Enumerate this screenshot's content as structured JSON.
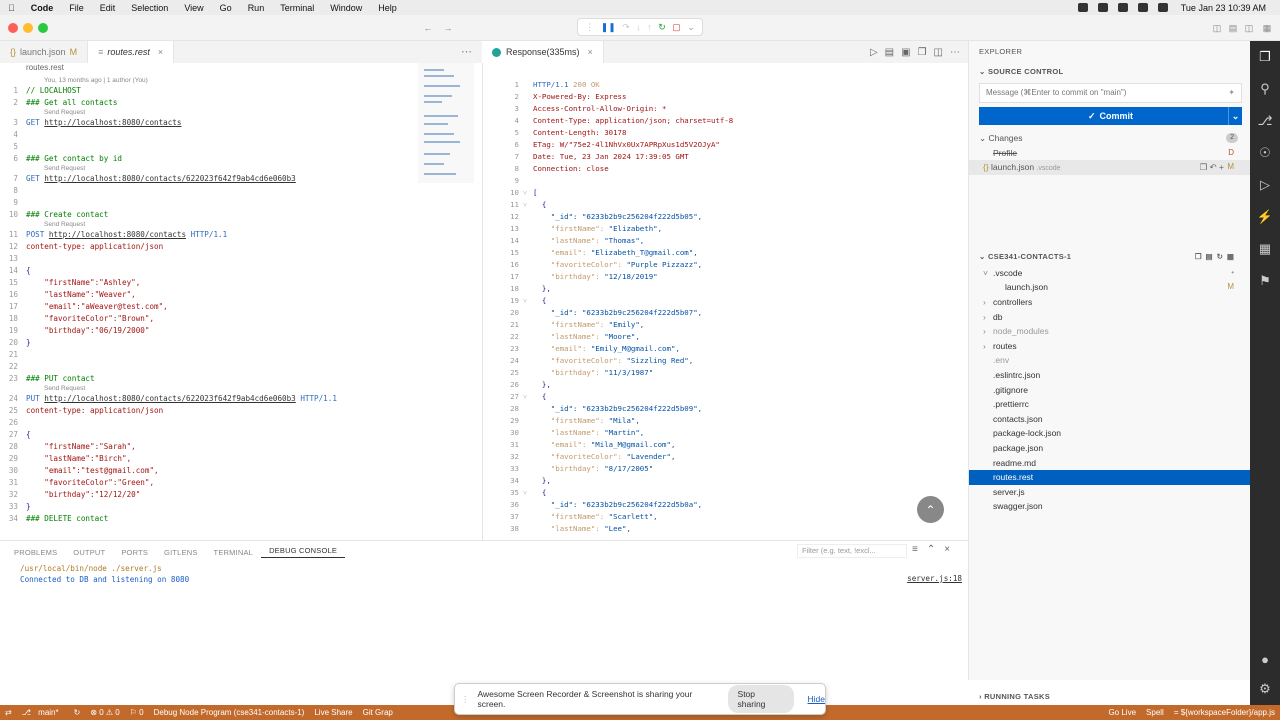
{
  "menubar": {
    "apple": "",
    "items": [
      "Code",
      "File",
      "Edit",
      "Selection",
      "View",
      "Go",
      "Run",
      "Terminal",
      "Window",
      "Help"
    ],
    "clock": "Tue Jan 23  10:39 AM"
  },
  "editor_tabs": [
    {
      "label": "launch.json",
      "mod": "M",
      "active": false
    },
    {
      "label": "routes.rest",
      "mod": "",
      "active": true
    }
  ],
  "response_tab": {
    "label": "Response(335ms)"
  },
  "editor": {
    "breadcrumb": "routes.rest",
    "blame": "You, 13 months ago | 1 author (You)",
    "lines": [
      {
        "n": "1",
        "hint": "",
        "parts": [
          {
            "t": "// LOCALHOST",
            "c": "k3"
          }
        ]
      },
      {
        "n": "2",
        "hint": "",
        "parts": [
          {
            "t": "### Get all contacts",
            "c": "k3"
          }
        ]
      },
      {
        "n": "",
        "hint": "Send Request",
        "parts": []
      },
      {
        "n": "3",
        "hint": "",
        "parts": [
          {
            "t": "GET ",
            "c": "k1"
          },
          {
            "t": "http://localhost:8080/contacts",
            "c": "k5"
          }
        ]
      },
      {
        "n": "4",
        "hint": "",
        "parts": []
      },
      {
        "n": "5",
        "hint": "",
        "parts": []
      },
      {
        "n": "6",
        "hint": "",
        "parts": [
          {
            "t": "### Get contact by id",
            "c": "k3"
          }
        ]
      },
      {
        "n": "",
        "hint": "Send Request",
        "parts": []
      },
      {
        "n": "7",
        "hint": "",
        "parts": [
          {
            "t": "GET ",
            "c": "k1"
          },
          {
            "t": "http://localhost:8080/contacts/622023f642f9ab4cd6e060b3",
            "c": "k5"
          }
        ]
      },
      {
        "n": "8",
        "hint": "",
        "parts": []
      },
      {
        "n": "9",
        "hint": "",
        "parts": []
      },
      {
        "n": "10",
        "hint": "",
        "parts": [
          {
            "t": "### Create contact",
            "c": "k3"
          }
        ]
      },
      {
        "n": "",
        "hint": "Send Request",
        "parts": []
      },
      {
        "n": "11",
        "hint": "",
        "parts": [
          {
            "t": "POST ",
            "c": "k1"
          },
          {
            "t": "http://localhost:8080/contacts",
            "c": "k5"
          },
          {
            "t": " HTTP/1.1",
            "c": "k1"
          }
        ]
      },
      {
        "n": "12",
        "hint": "",
        "parts": [
          {
            "t": "content-type: application/json",
            "c": "k2"
          }
        ]
      },
      {
        "n": "13",
        "hint": "",
        "parts": []
      },
      {
        "n": "14",
        "hint": "",
        "parts": [
          {
            "t": "{",
            "c": "kp"
          }
        ]
      },
      {
        "n": "15",
        "hint": "",
        "parts": [
          {
            "t": "    \"firstName\":\"Ashley\",",
            "c": "k2"
          }
        ]
      },
      {
        "n": "16",
        "hint": "",
        "parts": [
          {
            "t": "    \"lastName\":\"Weaver\",",
            "c": "k2"
          }
        ]
      },
      {
        "n": "17",
        "hint": "",
        "parts": [
          {
            "t": "    \"email\":\"aWeaver@test.com\",",
            "c": "k2"
          }
        ]
      },
      {
        "n": "18",
        "hint": "",
        "parts": [
          {
            "t": "    \"favoriteColor\":\"Brown\",",
            "c": "k2"
          }
        ]
      },
      {
        "n": "19",
        "hint": "",
        "parts": [
          {
            "t": "    \"birthday\":\"06/19/2000\"",
            "c": "k2"
          }
        ]
      },
      {
        "n": "20",
        "hint": "",
        "parts": [
          {
            "t": "}",
            "c": "kp"
          }
        ]
      },
      {
        "n": "21",
        "hint": "",
        "parts": []
      },
      {
        "n": "22",
        "hint": "",
        "parts": []
      },
      {
        "n": "23",
        "hint": "",
        "parts": [
          {
            "t": "### PUT contact",
            "c": "k3"
          }
        ]
      },
      {
        "n": "",
        "hint": "Send Request",
        "parts": []
      },
      {
        "n": "24",
        "hint": "",
        "parts": [
          {
            "t": "PUT ",
            "c": "k1"
          },
          {
            "t": "http://localhost:8080/contacts/622023f642f9ab4cd6e060b3",
            "c": "k5"
          },
          {
            "t": " HTTP/1.1",
            "c": "k1"
          }
        ]
      },
      {
        "n": "25",
        "hint": "",
        "parts": [
          {
            "t": "content-type: application/json",
            "c": "k2"
          }
        ]
      },
      {
        "n": "26",
        "hint": "",
        "parts": []
      },
      {
        "n": "27",
        "hint": "",
        "parts": [
          {
            "t": "{",
            "c": "kp"
          }
        ]
      },
      {
        "n": "28",
        "hint": "",
        "parts": [
          {
            "t": "    \"firstName\":\"Sarah\",",
            "c": "k2"
          }
        ]
      },
      {
        "n": "29",
        "hint": "",
        "parts": [
          {
            "t": "    \"lastName\":\"Birch\",",
            "c": "k2"
          }
        ]
      },
      {
        "n": "30",
        "hint": "",
        "parts": [
          {
            "t": "    \"email\":\"test@gmail.com\",",
            "c": "k2"
          }
        ]
      },
      {
        "n": "31",
        "hint": "",
        "parts": [
          {
            "t": "    \"favoriteColor\":\"Green\",",
            "c": "k2"
          }
        ]
      },
      {
        "n": "32",
        "hint": "",
        "parts": [
          {
            "t": "    \"birthday\":\"12/12/20\"",
            "c": "k2"
          }
        ]
      },
      {
        "n": "33",
        "hint": "",
        "parts": [
          {
            "t": "}",
            "c": "kp"
          }
        ]
      },
      {
        "n": "34",
        "hint": "",
        "parts": [
          {
            "t": "### DELETE contact",
            "c": "k3"
          }
        ]
      }
    ]
  },
  "response": {
    "lines": [
      {
        "n": "1",
        "f": "",
        "parts": [
          {
            "t": "HTTP/1.1 ",
            "c": "k1"
          },
          {
            "t": "200 OK",
            "c": "ks"
          }
        ]
      },
      {
        "n": "2",
        "f": "",
        "parts": [
          {
            "t": "X-Powered-By: Express",
            "c": "k2"
          }
        ]
      },
      {
        "n": "3",
        "f": "",
        "parts": [
          {
            "t": "Access-Control-Allow-Origin: *",
            "c": "k2"
          }
        ]
      },
      {
        "n": "4",
        "f": "",
        "parts": [
          {
            "t": "Content-Type: application/json; charset=utf-8",
            "c": "k2"
          }
        ]
      },
      {
        "n": "5",
        "f": "",
        "parts": [
          {
            "t": "Content-Length: 30178",
            "c": "k2"
          }
        ]
      },
      {
        "n": "6",
        "f": "",
        "parts": [
          {
            "t": "ETag: W/\"75e2-4l1NhVx0Ux7APRpXus1d5V2OJyA\"",
            "c": "k2"
          }
        ]
      },
      {
        "n": "7",
        "f": "",
        "parts": [
          {
            "t": "Date: Tue, 23 Jan 2024 17:39:05 GMT",
            "c": "k2"
          }
        ]
      },
      {
        "n": "8",
        "f": "",
        "parts": [
          {
            "t": "Connection: close",
            "c": "k2"
          }
        ]
      },
      {
        "n": "9",
        "f": "",
        "parts": []
      },
      {
        "n": "10",
        "f": "v",
        "parts": [
          {
            "t": "[",
            "c": "kp"
          }
        ]
      },
      {
        "n": "11",
        "f": "v",
        "parts": [
          {
            "t": "  {",
            "c": "kp"
          }
        ]
      },
      {
        "n": "12",
        "f": "",
        "parts": [
          {
            "t": "    \"_id\": ",
            "c": "k4"
          },
          {
            "t": "\"6233b2b9c256204f222d5b05\",",
            "c": "jv"
          }
        ]
      },
      {
        "n": "13",
        "f": "",
        "parts": [
          {
            "t": "    \"firstName\": ",
            "c": "ks"
          },
          {
            "t": "\"Elizabeth\",",
            "c": "jv"
          }
        ]
      },
      {
        "n": "14",
        "f": "",
        "parts": [
          {
            "t": "    \"lastName\": ",
            "c": "ks"
          },
          {
            "t": "\"Thomas\",",
            "c": "jv"
          }
        ]
      },
      {
        "n": "15",
        "f": "",
        "parts": [
          {
            "t": "    \"email\": ",
            "c": "ks"
          },
          {
            "t": "\"Elizabeth_T@gmail.com\",",
            "c": "jv"
          }
        ]
      },
      {
        "n": "16",
        "f": "",
        "parts": [
          {
            "t": "    \"favoriteColor\": ",
            "c": "ks"
          },
          {
            "t": "\"Purple Pizzazz\",",
            "c": "jv"
          }
        ]
      },
      {
        "n": "17",
        "f": "",
        "parts": [
          {
            "t": "    \"birthday\": ",
            "c": "ks"
          },
          {
            "t": "\"12/18/2019\"",
            "c": "jv"
          }
        ]
      },
      {
        "n": "18",
        "f": "",
        "parts": [
          {
            "t": "  },",
            "c": "kp"
          }
        ]
      },
      {
        "n": "19",
        "f": "v",
        "parts": [
          {
            "t": "  {",
            "c": "kp"
          }
        ]
      },
      {
        "n": "20",
        "f": "",
        "parts": [
          {
            "t": "    \"_id\": ",
            "c": "k4"
          },
          {
            "t": "\"6233b2b9c256204f222d5b07\",",
            "c": "jv"
          }
        ]
      },
      {
        "n": "21",
        "f": "",
        "parts": [
          {
            "t": "    \"firstName\": ",
            "c": "ks"
          },
          {
            "t": "\"Emily\",",
            "c": "jv"
          }
        ]
      },
      {
        "n": "22",
        "f": "",
        "parts": [
          {
            "t": "    \"lastName\": ",
            "c": "ks"
          },
          {
            "t": "\"Moore\",",
            "c": "jv"
          }
        ]
      },
      {
        "n": "23",
        "f": "",
        "parts": [
          {
            "t": "    \"email\": ",
            "c": "ks"
          },
          {
            "t": "\"Emily_M@gmail.com\",",
            "c": "jv"
          }
        ]
      },
      {
        "n": "24",
        "f": "",
        "parts": [
          {
            "t": "    \"favoriteColor\": ",
            "c": "ks"
          },
          {
            "t": "\"Sizzling Red\",",
            "c": "jv"
          }
        ]
      },
      {
        "n": "25",
        "f": "",
        "parts": [
          {
            "t": "    \"birthday\": ",
            "c": "ks"
          },
          {
            "t": "\"11/3/1987\"",
            "c": "jv"
          }
        ]
      },
      {
        "n": "26",
        "f": "",
        "parts": [
          {
            "t": "  },",
            "c": "kp"
          }
        ]
      },
      {
        "n": "27",
        "f": "v",
        "parts": [
          {
            "t": "  {",
            "c": "kp"
          }
        ]
      },
      {
        "n": "28",
        "f": "",
        "parts": [
          {
            "t": "    \"_id\": ",
            "c": "k4"
          },
          {
            "t": "\"6233b2b9c256204f222d5b09\",",
            "c": "jv"
          }
        ]
      },
      {
        "n": "29",
        "f": "",
        "parts": [
          {
            "t": "    \"firstName\": ",
            "c": "ks"
          },
          {
            "t": "\"Mila\",",
            "c": "jv"
          }
        ]
      },
      {
        "n": "30",
        "f": "",
        "parts": [
          {
            "t": "    \"lastName\": ",
            "c": "ks"
          },
          {
            "t": "\"Martin\",",
            "c": "jv"
          }
        ]
      },
      {
        "n": "31",
        "f": "",
        "parts": [
          {
            "t": "    \"email\": ",
            "c": "ks"
          },
          {
            "t": "\"Mila_M@gmail.com\",",
            "c": "jv"
          }
        ]
      },
      {
        "n": "32",
        "f": "",
        "parts": [
          {
            "t": "    \"favoriteColor\": ",
            "c": "ks"
          },
          {
            "t": "\"Lavender\",",
            "c": "jv"
          }
        ]
      },
      {
        "n": "33",
        "f": "",
        "parts": [
          {
            "t": "    \"birthday\": ",
            "c": "ks"
          },
          {
            "t": "\"8/17/2005\"",
            "c": "jv"
          }
        ]
      },
      {
        "n": "34",
        "f": "",
        "parts": [
          {
            "t": "  },",
            "c": "kp"
          }
        ]
      },
      {
        "n": "35",
        "f": "v",
        "parts": [
          {
            "t": "  {",
            "c": "kp"
          }
        ]
      },
      {
        "n": "36",
        "f": "",
        "parts": [
          {
            "t": "    \"_id\": ",
            "c": "k4"
          },
          {
            "t": "\"6233b2b9c256204f222d5b0a\",",
            "c": "jv"
          }
        ]
      },
      {
        "n": "37",
        "f": "",
        "parts": [
          {
            "t": "    \"firstName\": ",
            "c": "ks"
          },
          {
            "t": "\"Scarlett\",",
            "c": "jv"
          }
        ]
      },
      {
        "n": "38",
        "f": "",
        "parts": [
          {
            "t": "    \"lastName\": ",
            "c": "ks"
          },
          {
            "t": "\"Lee\",",
            "c": "jv"
          }
        ]
      }
    ]
  },
  "panel": {
    "tabs": [
      "PROBLEMS",
      "OUTPUT",
      "PORTS",
      "GITLENS",
      "TERMINAL",
      "DEBUG CONSOLE"
    ],
    "active_tab": "DEBUG CONSOLE",
    "filter_placeholder": "Filter (e.g. text, !excl...",
    "lines": [
      "/usr/local/bin/node ./server.js",
      "Connected to DB and listening on 8080"
    ],
    "source_ref": "server.js:18"
  },
  "sidebar": {
    "explorer": "EXPLORER",
    "source_control": "SOURCE CONTROL",
    "commit_placeholder": "Message (⌘Enter to commit on \"main\")",
    "commit_label": "Commit",
    "changes_label": "Changes",
    "changes_count": "2",
    "changes": [
      {
        "name": "Profile",
        "path": "",
        "dec": "D"
      },
      {
        "name": "launch.json",
        ".path": "",
        "path": ".vscode",
        "dec": "M"
      }
    ],
    "workspace": "CSE341-CONTACTS-1",
    "tree": [
      {
        "name": ".vscode",
        "indent": 1,
        "chev": "v",
        "dec": "•",
        "sel": false,
        "dim": false
      },
      {
        "name": "launch.json",
        "indent": 2,
        "chev": "",
        "dec": "M",
        "sel": false,
        "dim": false
      },
      {
        "name": "controllers",
        "indent": 1,
        "chev": ">",
        "dec": "",
        "sel": false,
        "dim": false
      },
      {
        "name": "db",
        "indent": 1,
        "chev": ">",
        "dec": "",
        "sel": false,
        "dim": false
      },
      {
        "name": "node_modules",
        "indent": 1,
        "chev": ">",
        "dec": "",
        "sel": false,
        "dim": true
      },
      {
        "name": "routes",
        "indent": 1,
        "chev": ">",
        "dec": "",
        "sel": false,
        "dim": false
      },
      {
        "name": ".env",
        "indent": 1,
        "chev": "",
        "dec": "",
        "sel": false,
        "dim": true
      },
      {
        "name": ".eslintrc.json",
        "indent": 1,
        "chev": "",
        "dec": "",
        "sel": false,
        "dim": false
      },
      {
        "name": ".gitignore",
        "indent": 1,
        "chev": "",
        "dec": "",
        "sel": false,
        "dim": false
      },
      {
        "name": ".prettierrc",
        "indent": 1,
        "chev": "",
        "dec": "",
        "sel": false,
        "dim": false
      },
      {
        "name": "contacts.json",
        "indent": 1,
        "chev": "",
        "dec": "",
        "sel": false,
        "dim": false
      },
      {
        "name": "package-lock.json",
        "indent": 1,
        "chev": "",
        "dec": "",
        "sel": false,
        "dim": false
      },
      {
        "name": "package.json",
        "indent": 1,
        "chev": "",
        "dec": "",
        "sel": false,
        "dim": false
      },
      {
        "name": "readme.md",
        "indent": 1,
        "chev": "",
        "dec": "",
        "sel": false,
        "dim": false
      },
      {
        "name": "routes.rest",
        "indent": 1,
        "chev": "",
        "dec": "",
        "sel": true,
        "dim": false
      },
      {
        "name": "server.js",
        "indent": 1,
        "chev": "",
        "dec": "",
        "sel": false,
        "dim": false
      },
      {
        "name": "swagger.json",
        "indent": 1,
        "chev": "",
        "dec": "",
        "sel": false,
        "dim": false
      }
    ],
    "running_tasks": "RUNNING TASKS"
  },
  "statusbar": {
    "left": [
      "main*",
      "⊗ 0 ⚠ 0",
      "⚐ 0",
      "Debug Node Program (cse341-contacts-1)",
      "Live Share",
      "Git Grap"
    ],
    "right": [
      "Go Live",
      "Spell",
      "= ${workspaceFolder}/app.js"
    ]
  },
  "share_bar": {
    "text": "Awesome Screen Recorder & Screenshot is sharing your screen.",
    "stop": "Stop sharing",
    "hide": "Hide"
  },
  "colors": {
    "accent": "#0060c0",
    "statusbar": "#c26a2b",
    "commit": "#0066cc"
  }
}
